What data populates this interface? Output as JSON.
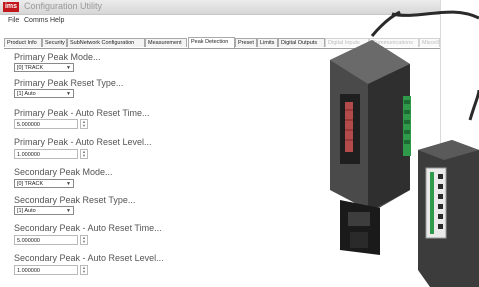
{
  "window": {
    "title": "Configuration Utility",
    "logo_text": "ims"
  },
  "menu": [
    "File",
    "Comms",
    "Help"
  ],
  "tabs": [
    {
      "label": "Product Info",
      "active": false,
      "faded": false
    },
    {
      "label": "Security",
      "active": false,
      "faded": false
    },
    {
      "label": "SubNetwork Configuration",
      "active": false,
      "faded": false
    },
    {
      "label": "Measurement",
      "active": false,
      "faded": false
    },
    {
      "label": "Peak Detection",
      "active": true,
      "faded": false
    },
    {
      "label": "Preset",
      "active": false,
      "faded": false
    },
    {
      "label": "Limits",
      "active": false,
      "faded": false
    },
    {
      "label": "Digital Outputs",
      "active": false,
      "faded": false
    },
    {
      "label": "Digital Inputs",
      "active": false,
      "faded": true
    },
    {
      "label": "Communications",
      "active": false,
      "faded": true
    },
    {
      "label": "Miscellaneous",
      "active": false,
      "faded": true
    }
  ],
  "fields": {
    "primary_peak_mode": {
      "label": "Primary Peak Mode...",
      "value": "[0] TRACK"
    },
    "primary_peak_reset_type": {
      "label": "Primary Peak Reset Type...",
      "value": "[1] Auto"
    },
    "primary_peak_auto_reset_time": {
      "label": "Primary Peak - Auto Reset Time...",
      "value": "5.000000"
    },
    "primary_peak_auto_reset_level": {
      "label": "Primary Peak - Auto Reset Level...",
      "value": "1.000000"
    },
    "secondary_peak_mode": {
      "label": "Secondary Peak Mode...",
      "value": "[0] TRACK"
    },
    "secondary_peak_reset_type": {
      "label": "Secondary Peak Reset Type...",
      "value": "[1] Auto"
    },
    "secondary_peak_auto_reset_time": {
      "label": "Secondary Peak - Auto Reset Time...",
      "value": "5.000000"
    },
    "secondary_peak_auto_reset_level": {
      "label": "Secondary Peak - Auto Reset Level...",
      "value": "1.000000"
    }
  },
  "icons": {
    "dropdown": "chevron-down-icon",
    "spinner_up": "spin-up-icon",
    "spinner_down": "spin-down-icon"
  },
  "colors": {
    "brand": "#c2181b",
    "device_body": "#3a3a3a",
    "device_panel": "#1f1f1f",
    "terminal_green": "#2f9a4a"
  }
}
